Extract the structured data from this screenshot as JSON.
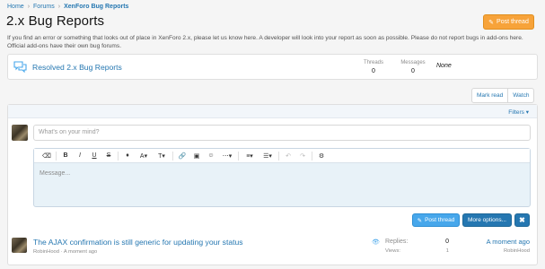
{
  "breadcrumb": {
    "items": [
      "Home",
      "Forums",
      "XenForo Bug Reports"
    ]
  },
  "page": {
    "title": "2.x Bug Reports",
    "post_thread_label": "Post thread",
    "description_line1": "If you find an error or something that looks out of place in XenForo 2.x, please let us know here. A developer will look into your report as soon as possible. Please do not report bugs in add-ons here.",
    "description_line2": "Official add-ons have their own bug forums."
  },
  "subforum": {
    "title": "Resolved 2.x Bug Reports",
    "threads_label": "Threads",
    "threads_value": "0",
    "messages_label": "Messages",
    "messages_value": "0",
    "last_post": "None"
  },
  "controls": {
    "mark_read_label": "Mark read",
    "watch_label": "Watch",
    "filters_label": "Filters ▾"
  },
  "quick_thread": {
    "title_placeholder": "What's on your mind?",
    "message_placeholder": "Message...",
    "post_thread_label": "Post thread",
    "more_options_label": "More options...",
    "close_label": "✖"
  },
  "toolbar": {
    "buttons": [
      "eraser-icon",
      "bold-icon",
      "italic-icon",
      "underline-icon",
      "strikethrough-icon",
      "font-color-icon",
      "font-size-icon",
      "link-icon",
      "image-icon",
      "smilie-icon",
      "more-icon",
      "align-icon",
      "list-icon",
      "undo-icon",
      "redo-icon",
      "settings-icon"
    ]
  },
  "threads": [
    {
      "title": "The AJAX confirmation is still generic for updating your status",
      "author": "RobinHood",
      "date": "A moment ago",
      "replies_label": "Replies:",
      "replies_value": "0",
      "views_label": "Views:",
      "views_value": "1",
      "last_date": "A moment ago",
      "last_user": "RobinHood"
    }
  ],
  "colors": {
    "link": "#2577b1",
    "accent_orange": "#f7a33a",
    "button_primary": "#2577b1",
    "button_light": "#47a7eb"
  }
}
